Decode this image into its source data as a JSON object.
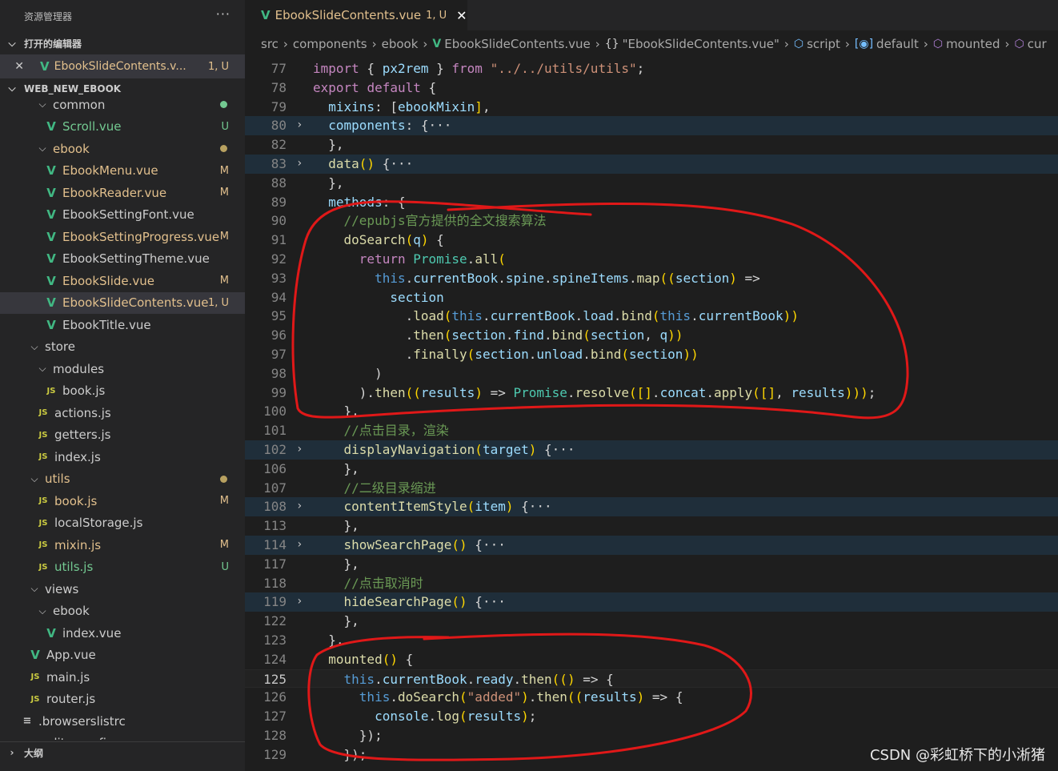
{
  "sidebar": {
    "title": "资源管理器",
    "more": "···",
    "open_editors_label": "打开的编辑器",
    "open_editor": {
      "name": "EbookSlideContents.v...",
      "status": "1, U"
    },
    "workspace_label": "WEB_NEW_EBOOK",
    "tree": [
      {
        "label": "common",
        "type": "folder",
        "indent": 1,
        "status": "dot-green"
      },
      {
        "label": "Scroll.vue",
        "type": "vue",
        "indent": 2,
        "status": "U"
      },
      {
        "label": "ebook",
        "type": "folder",
        "indent": 1,
        "status": "dot-yellow",
        "open": true
      },
      {
        "label": "EbookMenu.vue",
        "type": "vue",
        "indent": 2,
        "status": "M"
      },
      {
        "label": "EbookReader.vue",
        "type": "vue",
        "indent": 2,
        "status": "M"
      },
      {
        "label": "EbookSettingFont.vue",
        "type": "vue",
        "indent": 2,
        "status": ""
      },
      {
        "label": "EbookSettingProgress.vue",
        "type": "vue",
        "indent": 2,
        "status": "M"
      },
      {
        "label": "EbookSettingTheme.vue",
        "type": "vue",
        "indent": 2,
        "status": ""
      },
      {
        "label": "EbookSlide.vue",
        "type": "vue",
        "indent": 2,
        "status": "M"
      },
      {
        "label": "EbookSlideContents.vue",
        "type": "vue",
        "indent": 2,
        "status": "1, U",
        "active": true
      },
      {
        "label": "EbookTitle.vue",
        "type": "vue",
        "indent": 2,
        "status": ""
      },
      {
        "label": "store",
        "type": "folder",
        "indent": 0,
        "status": "",
        "open": true
      },
      {
        "label": "modules",
        "type": "folder",
        "indent": 1,
        "status": "",
        "open": true
      },
      {
        "label": "book.js",
        "type": "js",
        "indent": 2,
        "status": ""
      },
      {
        "label": "actions.js",
        "type": "js",
        "indent": 1,
        "status": ""
      },
      {
        "label": "getters.js",
        "type": "js",
        "indent": 1,
        "status": ""
      },
      {
        "label": "index.js",
        "type": "js",
        "indent": 1,
        "status": ""
      },
      {
        "label": "utils",
        "type": "folder",
        "indent": 0,
        "status": "dot-yellow",
        "open": true
      },
      {
        "label": "book.js",
        "type": "js",
        "indent": 1,
        "status": "M"
      },
      {
        "label": "localStorage.js",
        "type": "js",
        "indent": 1,
        "status": ""
      },
      {
        "label": "mixin.js",
        "type": "js",
        "indent": 1,
        "status": "M"
      },
      {
        "label": "utils.js",
        "type": "js",
        "indent": 1,
        "status": "U"
      },
      {
        "label": "views",
        "type": "folder",
        "indent": 0,
        "status": "",
        "open": true
      },
      {
        "label": "ebook",
        "type": "folder",
        "indent": 1,
        "status": "",
        "open": true
      },
      {
        "label": "index.vue",
        "type": "vue",
        "indent": 2,
        "status": ""
      },
      {
        "label": "App.vue",
        "type": "vue",
        "indent": 0,
        "status": ""
      },
      {
        "label": "main.js",
        "type": "js",
        "indent": 0,
        "status": ""
      },
      {
        "label": "router.js",
        "type": "js",
        "indent": 0,
        "status": ""
      },
      {
        "label": ".browserslistrc",
        "type": "cfg",
        "indent": -1,
        "status": ""
      },
      {
        "label": ".editorconfig",
        "type": "cfg",
        "indent": -1,
        "status": ""
      }
    ],
    "outline_label": "大纲"
  },
  "editor": {
    "tab": {
      "name": "EbookSlideContents.vue",
      "status": "1, U"
    },
    "breadcrumb": [
      "src",
      "components",
      "ebook",
      "EbookSlideContents.vue",
      "\"EbookSlideContents.vue\"",
      "script",
      "default",
      "mounted",
      "cur"
    ],
    "lines": [
      {
        "n": "77",
        "code": "import { px2rem } from \"../../utils/utils\";"
      },
      {
        "n": "78",
        "code": "export default {"
      },
      {
        "n": "79",
        "code": "  mixins: [ebookMixin],"
      },
      {
        "n": "80",
        "code": "  components: {···",
        "fold": true
      },
      {
        "n": "82",
        "code": "  },"
      },
      {
        "n": "83",
        "code": "  data() {···",
        "fold": true
      },
      {
        "n": "88",
        "code": "  },"
      },
      {
        "n": "89",
        "code": "  methods: {"
      },
      {
        "n": "90",
        "code": "    //epubjs官方提供的全文搜索算法"
      },
      {
        "n": "91",
        "code": "    doSearch(q) {"
      },
      {
        "n": "92",
        "code": "      return Promise.all("
      },
      {
        "n": "93",
        "code": "        this.currentBook.spine.spineItems.map((section) =>"
      },
      {
        "n": "94",
        "code": "          section"
      },
      {
        "n": "95",
        "code": "            .load(this.currentBook.load.bind(this.currentBook))"
      },
      {
        "n": "96",
        "code": "            .then(section.find.bind(section, q))"
      },
      {
        "n": "97",
        "code": "            .finally(section.unload.bind(section))"
      },
      {
        "n": "98",
        "code": "        )"
      },
      {
        "n": "99",
        "code": "      ).then((results) => Promise.resolve([].concat.apply([], results)));"
      },
      {
        "n": "100",
        "code": "    },"
      },
      {
        "n": "101",
        "code": "    //点击目录，渲染"
      },
      {
        "n": "102",
        "code": "    displayNavigation(target) {···",
        "fold": true
      },
      {
        "n": "106",
        "code": "    },"
      },
      {
        "n": "107",
        "code": "    //二级目录缩进"
      },
      {
        "n": "108",
        "code": "    contentItemStyle(item) {···",
        "fold": true
      },
      {
        "n": "113",
        "code": "    },"
      },
      {
        "n": "114",
        "code": "    showSearchPage() {···",
        "fold": true
      },
      {
        "n": "117",
        "code": "    },"
      },
      {
        "n": "118",
        "code": "    //点击取消时"
      },
      {
        "n": "119",
        "code": "    hideSearchPage() {···",
        "fold": true
      },
      {
        "n": "122",
        "code": "    },"
      },
      {
        "n": "123",
        "code": "  },"
      },
      {
        "n": "124",
        "code": "  mounted() {"
      },
      {
        "n": "125",
        "code": "    this.currentBook.ready.then(() => {",
        "current": true
      },
      {
        "n": "126",
        "code": "      this.doSearch(\"added\").then((results) => {"
      },
      {
        "n": "127",
        "code": "        console.log(results);"
      },
      {
        "n": "128",
        "code": "      });"
      },
      {
        "n": "129",
        "code": "    });"
      }
    ]
  },
  "watermark": "CSDN @彩虹桥下的小淅猪",
  "colors": {
    "annotation": "#e01818",
    "modified": "#e2c08d",
    "untracked": "#73c991",
    "vue": "#41b883"
  }
}
